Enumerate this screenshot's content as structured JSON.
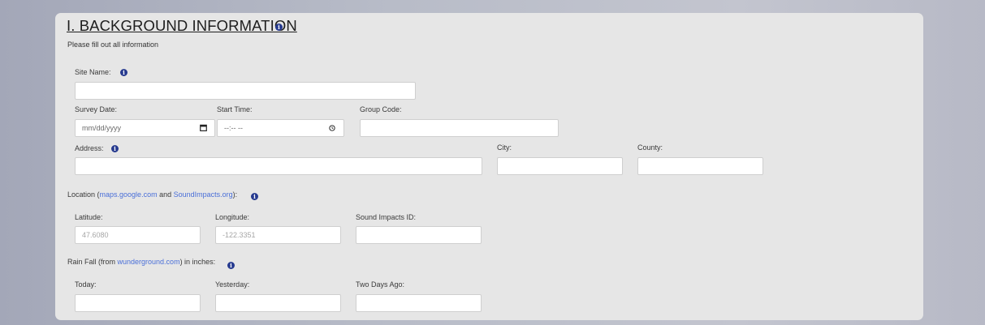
{
  "section": {
    "title": "I. BACKGROUND INFORMATION",
    "subtitle": "Please fill out all information"
  },
  "icons": {
    "info": "info-icon",
    "calendar": "calendar-icon",
    "clock": "clock-icon"
  },
  "colors": {
    "panel_bg": "#e6e6e6",
    "info_icon": "#263a8f",
    "link": "#4a6fd8"
  },
  "fields": {
    "site_name": {
      "label": "Site Name:",
      "value": ""
    },
    "survey_date": {
      "label": "Survey Date:",
      "placeholder": "mm/dd/yyyy"
    },
    "start_time": {
      "label": "Start Time:",
      "placeholder": "--:-- --"
    },
    "group_code": {
      "label": "Group Code:",
      "value": ""
    },
    "address": {
      "label": "Address:",
      "value": ""
    },
    "city": {
      "label": "City:",
      "value": ""
    },
    "county": {
      "label": "County:",
      "value": ""
    },
    "latitude": {
      "label": "Latitude:",
      "placeholder": "47.6080"
    },
    "longitude": {
      "label": "Longitude:",
      "placeholder": "-122.3351"
    },
    "sound_impacts_id": {
      "label": "Sound Impacts ID:",
      "value": ""
    },
    "today": {
      "label": "Today:",
      "value": ""
    },
    "yesterday": {
      "label": "Yesterday:",
      "value": ""
    },
    "two_days_ago": {
      "label": "Two Days Ago:",
      "value": ""
    }
  },
  "location": {
    "prefix": "Location (",
    "link1": "maps.google.com",
    "middle": " and ",
    "link2": "SoundImpacts.org",
    "suffix": "):"
  },
  "rainfall": {
    "prefix": "Rain Fall (from ",
    "link": "wunderground.com",
    "suffix": ") in inches:"
  }
}
